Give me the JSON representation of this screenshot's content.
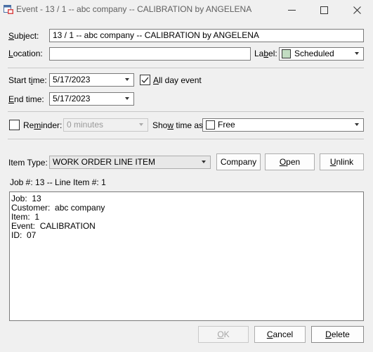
{
  "window": {
    "title": "Event - 13 / 1 -- abc company -- CALIBRATION by ANGELENA"
  },
  "subject": {
    "label_u": "S",
    "label_rest": "ubject:",
    "value": "13 / 1 -- abc company -- CALIBRATION by ANGELENA"
  },
  "location": {
    "label_u": "L",
    "label_rest": "ocation:",
    "value": ""
  },
  "label": {
    "label_pre": "La",
    "label_u": "b",
    "label_rest": "el:",
    "value": "Scheduled",
    "swatch_color": "#c2dcc2"
  },
  "start_time": {
    "label_pre": "Start t",
    "label_u": "i",
    "label_rest": "me:",
    "value": "5/17/2023"
  },
  "end_time": {
    "label_u": "E",
    "label_rest": "nd time:",
    "value": "5/17/2023"
  },
  "all_day": {
    "label_u": "A",
    "label_rest": "ll day event",
    "checked": true
  },
  "reminder": {
    "label_pre": "Re",
    "label_u": "m",
    "label_rest": "inder:",
    "checked": false,
    "value": "0 minutes"
  },
  "show_time_as": {
    "label_pre": "Sho",
    "label_u": "w",
    "label_rest": " time as:",
    "value": "Free"
  },
  "item_type": {
    "label": "Item Type:",
    "value": "WORK ORDER LINE ITEM"
  },
  "buttons": {
    "company": "Company",
    "open_u": "O",
    "open_rest": "pen",
    "unlink_u": "U",
    "unlink_rest": "nlink",
    "ok_u": "O",
    "ok_rest": "K",
    "cancel_u": "C",
    "cancel_rest": "ancel",
    "delete_u": "D",
    "delete_rest": "elete"
  },
  "job_line": "Job #: 13 -- Line Item #: 1",
  "notes": [
    "Job:  13",
    "Customer:  abc company",
    "Item:  1",
    "Event:  CALIBRATION",
    "ID:  07"
  ]
}
